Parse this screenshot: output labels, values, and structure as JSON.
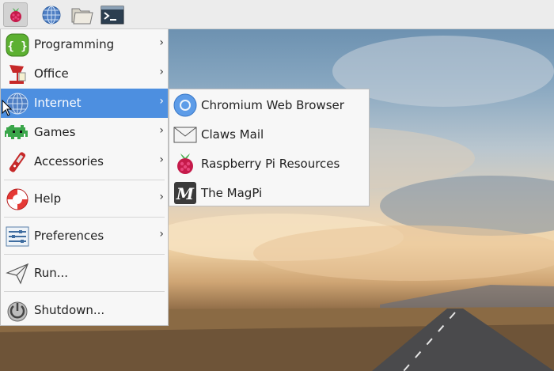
{
  "taskbar": {
    "buttons": [
      {
        "name": "raspberry-menu-icon"
      },
      {
        "name": "web-browser-icon"
      },
      {
        "name": "file-manager-icon"
      },
      {
        "name": "terminal-icon"
      }
    ]
  },
  "menu": {
    "items": [
      {
        "label": "Programming",
        "icon": "programming-icon",
        "has_submenu": true
      },
      {
        "label": "Office",
        "icon": "office-icon",
        "has_submenu": true
      },
      {
        "label": "Internet",
        "icon": "internet-icon",
        "has_submenu": true,
        "selected": true
      },
      {
        "label": "Games",
        "icon": "games-icon",
        "has_submenu": true
      },
      {
        "label": "Accessories",
        "icon": "accessories-icon",
        "has_submenu": true
      },
      {
        "label": "Help",
        "icon": "help-icon",
        "has_submenu": true
      },
      {
        "label": "Preferences",
        "icon": "preferences-icon",
        "has_submenu": true
      },
      {
        "label": "Run...",
        "icon": "run-icon",
        "has_submenu": false
      },
      {
        "label": "Shutdown...",
        "icon": "shutdown-icon",
        "has_submenu": false
      }
    ],
    "chevron": "›"
  },
  "submenu": {
    "items": [
      {
        "label": "Chromium Web Browser",
        "icon": "chromium-icon"
      },
      {
        "label": "Claws Mail",
        "icon": "mail-icon"
      },
      {
        "label": "Raspberry Pi Resources",
        "icon": "raspberry-pi-icon"
      },
      {
        "label": "The MagPi",
        "icon": "magpi-icon"
      }
    ]
  },
  "colors": {
    "selection": "#4d8fe0",
    "menu_bg": "#f7f7f7",
    "taskbar_bg": "#ececec"
  }
}
